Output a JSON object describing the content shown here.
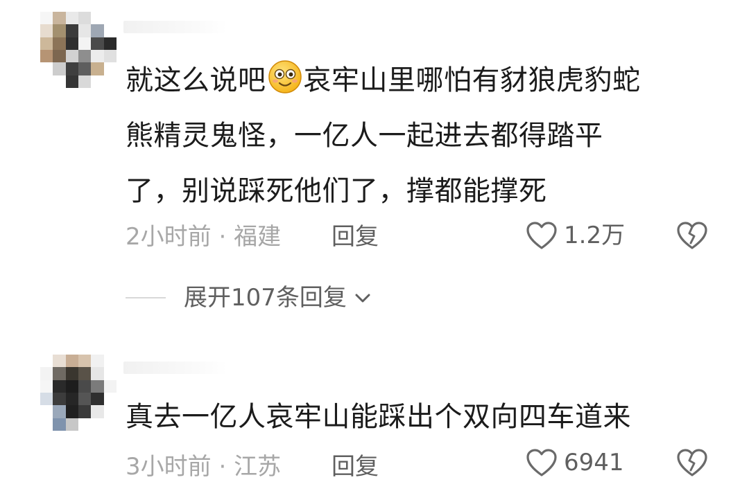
{
  "comments": [
    {
      "text_before_emoji": "就这么说吧",
      "emoji": "smile-emoji",
      "text_after_emoji": "哀牢山里哪怕有豺狼虎豹蛇",
      "text_line2": "熊精灵鬼怪，一亿人一起进去都得踏平",
      "text_line3": "了，别说踩死他们了，撑都能撑死",
      "time": "2小时前",
      "separator": "·",
      "location": "福建",
      "reply_label": "回复",
      "like_count": "1.2万",
      "expand_label": "展开107条回复"
    },
    {
      "text_line1": "真去一亿人哀牢山能踩出个双向四车道来",
      "time": "3小时前",
      "separator": "·",
      "location": "江苏",
      "reply_label": "回复",
      "like_count": "6941"
    }
  ],
  "icons": {
    "like": "heart-outline-icon",
    "dislike": "broken-heart-icon",
    "expand": "chevron-down-icon"
  },
  "colors": {
    "text": "#1b1b1b",
    "meta": "#a7a7a7",
    "action": "#5f5f5f",
    "icon": "#6a6a6a"
  }
}
